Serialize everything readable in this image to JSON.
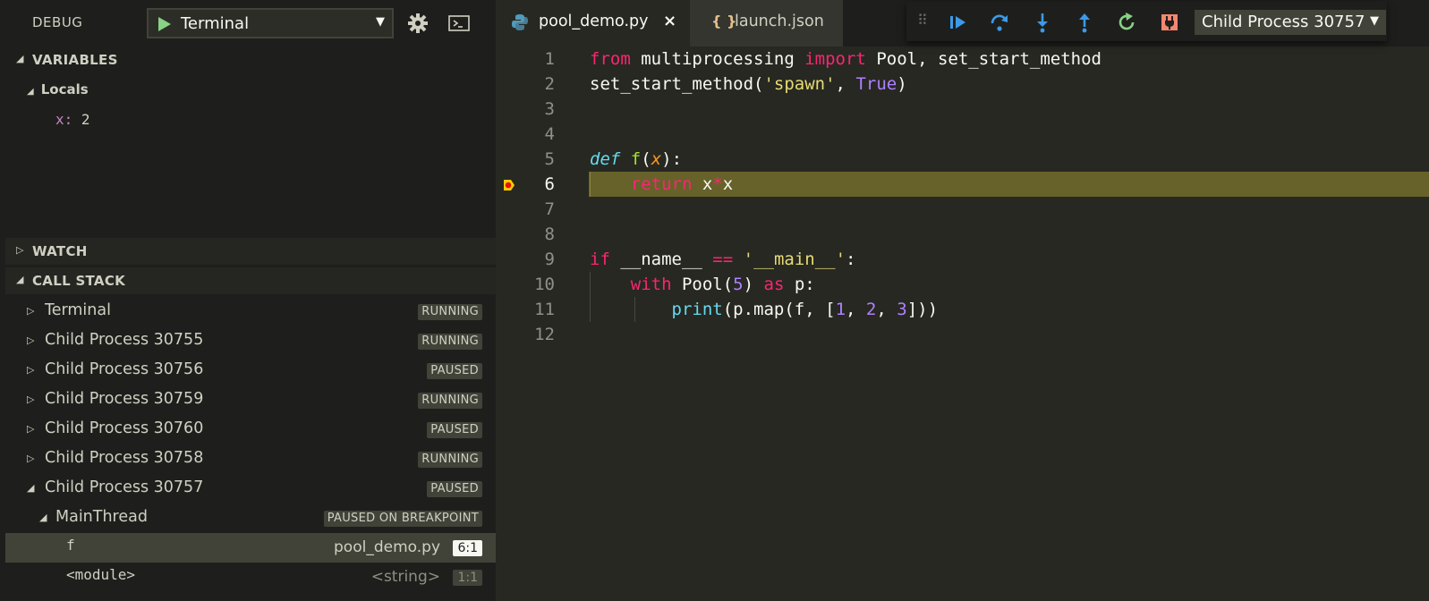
{
  "debug": {
    "title": "DEBUG",
    "launch_config": "Terminal",
    "icons": [
      "start-debug-icon",
      "gear-icon",
      "console-icon"
    ]
  },
  "sections": {
    "variables": "VARIABLES",
    "locals": "Locals",
    "watch": "WATCH",
    "call_stack": "CALL STACK"
  },
  "variables": [
    {
      "name": "x",
      "sep": ": ",
      "value": "2"
    }
  ],
  "call_stack": {
    "processes": [
      {
        "name": "Terminal",
        "state": "RUNNING"
      },
      {
        "name": "Child Process 30755",
        "state": "RUNNING"
      },
      {
        "name": "Child Process 30756",
        "state": "PAUSED"
      },
      {
        "name": "Child Process 30759",
        "state": "RUNNING"
      },
      {
        "name": "Child Process 30760",
        "state": "PAUSED"
      },
      {
        "name": "Child Process 30758",
        "state": "RUNNING"
      },
      {
        "name": "Child Process 30757",
        "state": "PAUSED"
      }
    ],
    "thread": {
      "name": "MainThread",
      "state": "PAUSED ON BREAKPOINT"
    },
    "frames": [
      {
        "name": "f",
        "file": "pool_demo.py",
        "pos": "6:1"
      },
      {
        "name": "<module>",
        "file": "<string>",
        "pos": "1:1"
      }
    ]
  },
  "tabs": [
    {
      "label": "pool_demo.py",
      "icon": "python-file-icon",
      "close": "×"
    },
    {
      "label": "launch.json",
      "icon": "json-file-icon",
      "glyph": "{ }"
    }
  ],
  "editor": {
    "line_numbers": [
      "1",
      "2",
      "3",
      "4",
      "5",
      "6",
      "7",
      "8",
      "9",
      "10",
      "11",
      "12"
    ],
    "current_line": 6,
    "breakpoint_line": 6
  },
  "toolbar": {
    "grip": "⠿",
    "process": "Child Process 30757",
    "buttons": [
      "continue-icon",
      "step-over-icon",
      "step-into-icon",
      "step-out-icon",
      "restart-icon",
      "disconnect-icon"
    ]
  },
  "colors": {
    "accent_blue": "#3c9ae8",
    "restart_green": "#89d185",
    "disconnect_red": "#f48771",
    "keyword": "#f92672",
    "string": "#e6db74",
    "number": "#ae81ff",
    "current_line": "#67622a"
  }
}
